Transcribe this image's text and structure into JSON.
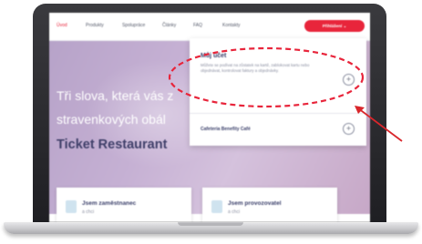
{
  "nav": {
    "items": [
      "Úvod",
      "Produkty",
      "Spolupráce",
      "Články",
      "FAQ",
      "Kontakty"
    ],
    "cta": "Přihlášení"
  },
  "hero": {
    "line1": "Tři slova, která vás z",
    "line2": "stravenkových obál",
    "brand": "Ticket Restaurant"
  },
  "dropdown": {
    "title": "Můj účet",
    "description": "Můžete se podívat na zůstatek na kartě, zablokovat kartu nebo objednávat, kontrolovat faktury a objednávky.",
    "item2": "Cafeteria Benefity Café",
    "plus_glyph": "+"
  },
  "cards": [
    {
      "title": "Jsem zaměstnanec",
      "sub": "a chci"
    },
    {
      "title": "Jsem provozovatel",
      "sub": "a chci"
    }
  ],
  "annotation_color": "#e8253b"
}
